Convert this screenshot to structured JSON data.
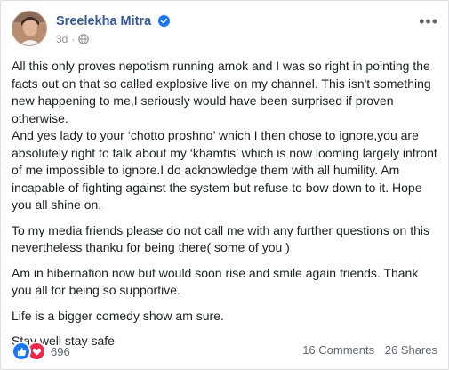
{
  "post": {
    "author": "Sreelekha Mitra",
    "time": "3d",
    "separator": "·",
    "paragraphs": [
      "All this only proves nepotism running amok and I was so right in pointing the facts out on that so called explosive live on my channel. This isn't something new happening to me,I seriously would have been surprised if proven otherwise.\nAnd yes lady to your ‘chotto proshno’ which I then chose to ignore,you are absolutely right to talk about my ‘khamtis’ which is now looming largely infront of me impossible to ignore.I do acknowledge them with all humility. Am incapable of fighting against the system but refuse to bow down to it. Hope you all shine on.",
      "To my media friends please do not call me with any further questions on this nevertheless thanku for being there( some of you )",
      "Am in hibernation now but would soon rise and smile again friends. Thank you all for being so supportive.",
      "Life is a bigger comedy show am sure.",
      "Stay well stay safe"
    ]
  },
  "footer": {
    "reaction_count": "696",
    "comments": "16 Comments",
    "shares": "26 Shares"
  },
  "icons": {
    "like": "like-icon",
    "love": "love-icon",
    "verified": "verified-badge-icon",
    "privacy": "globe-icon",
    "more": "more-options-icon"
  },
  "colors": {
    "author_link": "#385898",
    "verified": "#1877f2",
    "like": "#1877f2",
    "love": "#f0284a",
    "secondary_text": "#606770"
  }
}
